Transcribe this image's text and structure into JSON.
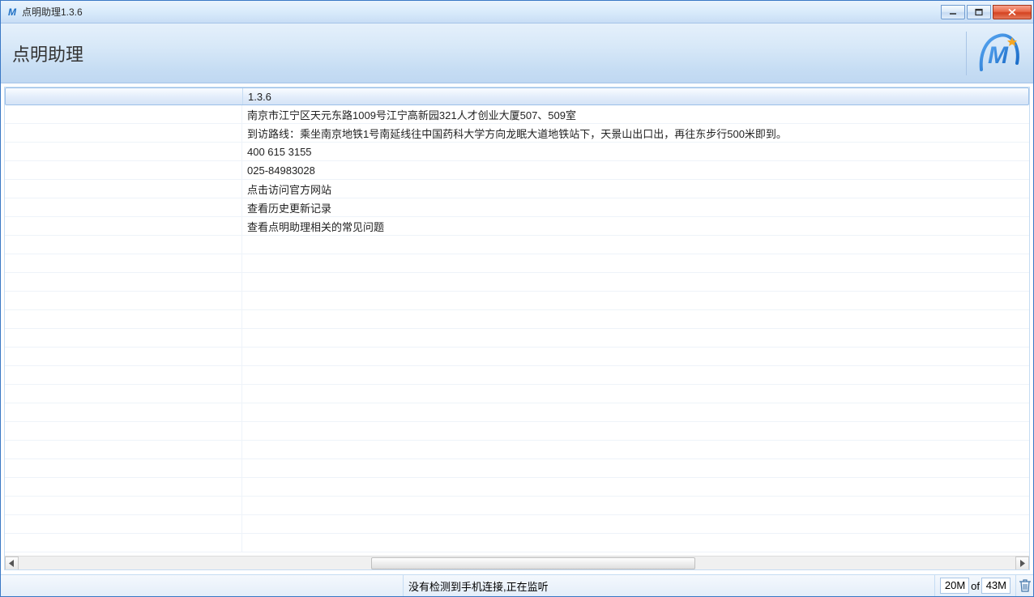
{
  "window": {
    "title": "点明助理1.3.6"
  },
  "header": {
    "title": "点明助理"
  },
  "rows": [
    {
      "label": "",
      "value": "1.3.6"
    },
    {
      "label": "",
      "value": "南京市江宁区天元东路1009号江宁高新园321人才创业大厦507、509室"
    },
    {
      "label": "",
      "value": "到访路线：乘坐南京地铁1号南延线往中国药科大学方向龙眠大道地铁站下，天景山出口出，再往东步行500米即到。"
    },
    {
      "label": "",
      "value": "400 615 3155"
    },
    {
      "label": "",
      "value": "025-84983028"
    },
    {
      "label": "",
      "value": "点击访问官方网站"
    },
    {
      "label": "",
      "value": "查看历史更新记录"
    },
    {
      "label": "",
      "value": "查看点明助理相关的常见问题"
    }
  ],
  "status": {
    "message": "没有检测到手机连接,正在监听",
    "mem_used": "20M",
    "mem_of": "of",
    "mem_total": "43M"
  }
}
